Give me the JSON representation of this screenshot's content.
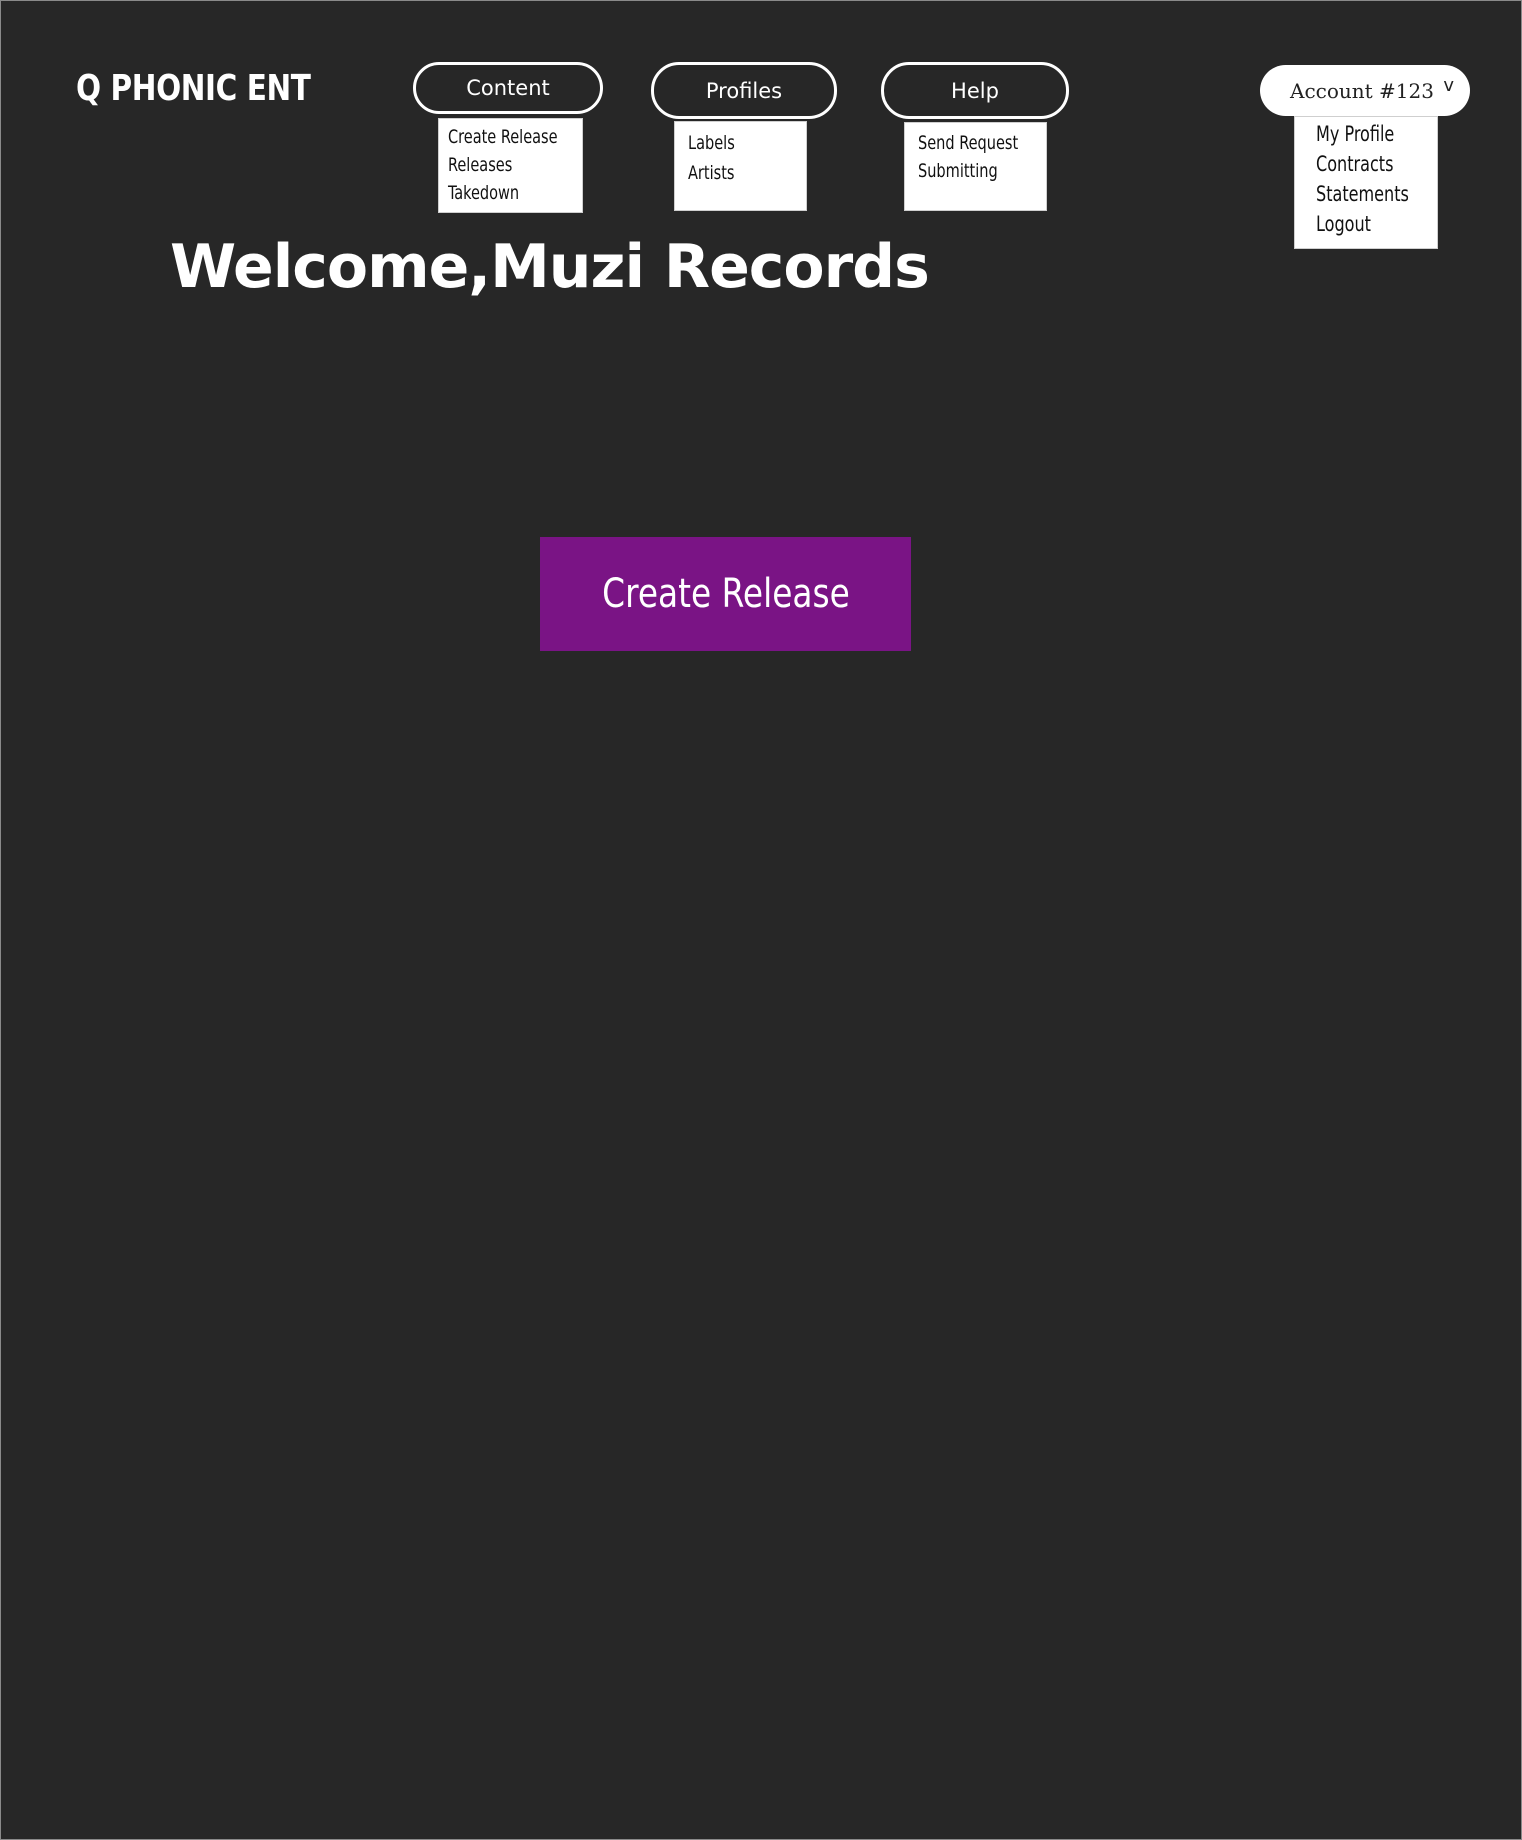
{
  "header": {
    "logo": "Q PHONIC ENT",
    "nav": {
      "content": {
        "label": "Content",
        "items": [
          "Create Release",
          "Releases",
          "Takedown"
        ]
      },
      "profiles": {
        "label": "Profiles",
        "items": [
          "Labels",
          "Artists"
        ]
      },
      "help": {
        "label": "Help",
        "items": [
          "Send Request",
          "Submitting"
        ]
      }
    },
    "account": {
      "label": "Account #123",
      "chevron": "v",
      "items": [
        "My Profile",
        "Contracts",
        "Statements",
        "Logout"
      ]
    }
  },
  "main": {
    "welcome": "Welcome,Muzi Records",
    "cta_label": "Create Release"
  },
  "colors": {
    "background": "#272727",
    "accent": "#7a1485",
    "text": "#ffffff"
  }
}
